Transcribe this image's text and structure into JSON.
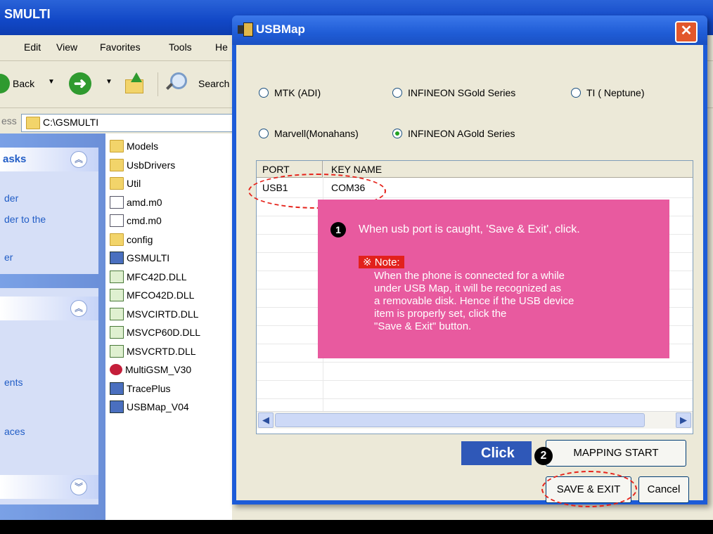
{
  "explorer": {
    "title": "SMULTI",
    "menu": [
      "Edit",
      "View",
      "Favorites",
      "Tools",
      "He"
    ],
    "toolbar": {
      "back": "Back",
      "search": "Search"
    },
    "address": {
      "label": "ess",
      "value": "C:\\GSMULTI"
    },
    "sidebar": {
      "panel1_title": "asks",
      "panel1_links": [
        "der",
        "der to the",
        "er"
      ],
      "panel2_links": [
        "ents",
        "aces"
      ]
    },
    "files": [
      {
        "name": "Models",
        "icon": "folder-icon"
      },
      {
        "name": "UsbDrivers",
        "icon": "folder-icon"
      },
      {
        "name": "Util",
        "icon": "folder-icon"
      },
      {
        "name": "amd.m0",
        "icon": "document-icon"
      },
      {
        "name": "cmd.m0",
        "icon": "document-icon"
      },
      {
        "name": "config",
        "icon": "config-icon"
      },
      {
        "name": "GSMULTI",
        "icon": "app-icon"
      },
      {
        "name": "MFC42D.DLL",
        "icon": "dll-icon"
      },
      {
        "name": "MFCO42D.DLL",
        "icon": "dll-icon"
      },
      {
        "name": "MSVCIRTD.DLL",
        "icon": "dll-icon"
      },
      {
        "name": "MSVCP60D.DLL",
        "icon": "dll-icon"
      },
      {
        "name": "MSVCRTD.DLL",
        "icon": "dll-icon"
      },
      {
        "name": "MultiGSM_V30",
        "icon": "lg-icon"
      },
      {
        "name": "TracePlus",
        "icon": "app-icon"
      },
      {
        "name": "USBMap_V04",
        "icon": "app-icon"
      }
    ]
  },
  "dialog": {
    "title": "USBMap",
    "close": "✕",
    "radios": [
      {
        "label": "MTK (ADI)",
        "selected": false
      },
      {
        "label": "INFINEON SGold Series",
        "selected": false
      },
      {
        "label": "TI ( Neptune)",
        "selected": false
      },
      {
        "label": "Marvell(Monahans)",
        "selected": false
      },
      {
        "label": "INFINEON AGold Series",
        "selected": true
      }
    ],
    "list": {
      "columns": [
        "PORT",
        "KEY NAME"
      ],
      "rows": [
        [
          "USB1",
          "COM36"
        ]
      ]
    },
    "buttons": {
      "mapping": "MAPPING START",
      "save": "SAVE & EXIT",
      "cancel": "Cancel"
    }
  },
  "callout": {
    "step1_badge": "1",
    "step1_text": "When usb port is caught, 'Save & Exit', click.",
    "note_tag": "※ Note:",
    "note_lines": [
      "When the phone is connected for a while",
      "under USB Map, it will be recognized as",
      "a removable disk. Hence if the USB device",
      "item is properly set, click the",
      "\"Save & Exit\" button."
    ],
    "click_label": "Click",
    "step2_badge": "2"
  },
  "colors": {
    "title_blue": "#1f5cd6",
    "pink_callout": "#e85a9f",
    "note_red": "#e2211c",
    "dash_red": "#e5231b"
  }
}
